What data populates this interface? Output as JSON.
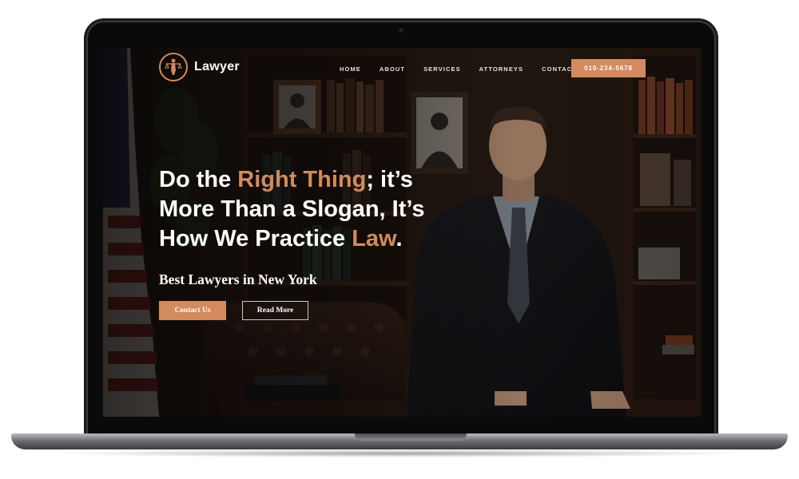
{
  "site": {
    "logo_text": "Lawyer",
    "nav": [
      "HOME",
      "ABOUT",
      "SERVICES",
      "ATTORNEYS",
      "CONTACT"
    ],
    "phone": "010-234-5678"
  },
  "hero": {
    "title_1a": "Do the ",
    "title_1b": "Right Thing",
    "title_1c": "; it’s",
    "title_2": "More Than a Slogan, It’s",
    "title_3a": "How We Practice ",
    "title_3b": "Law",
    "title_3c": ".",
    "subtitle": "Best Lawyers in New York",
    "primary_button": "Contact Us",
    "secondary_button": "Read More"
  },
  "colors": {
    "accent": "#d28a5e",
    "background": "#17110d",
    "text": "#ffffff"
  },
  "icons": {
    "logo": "lady-justice-icon"
  }
}
